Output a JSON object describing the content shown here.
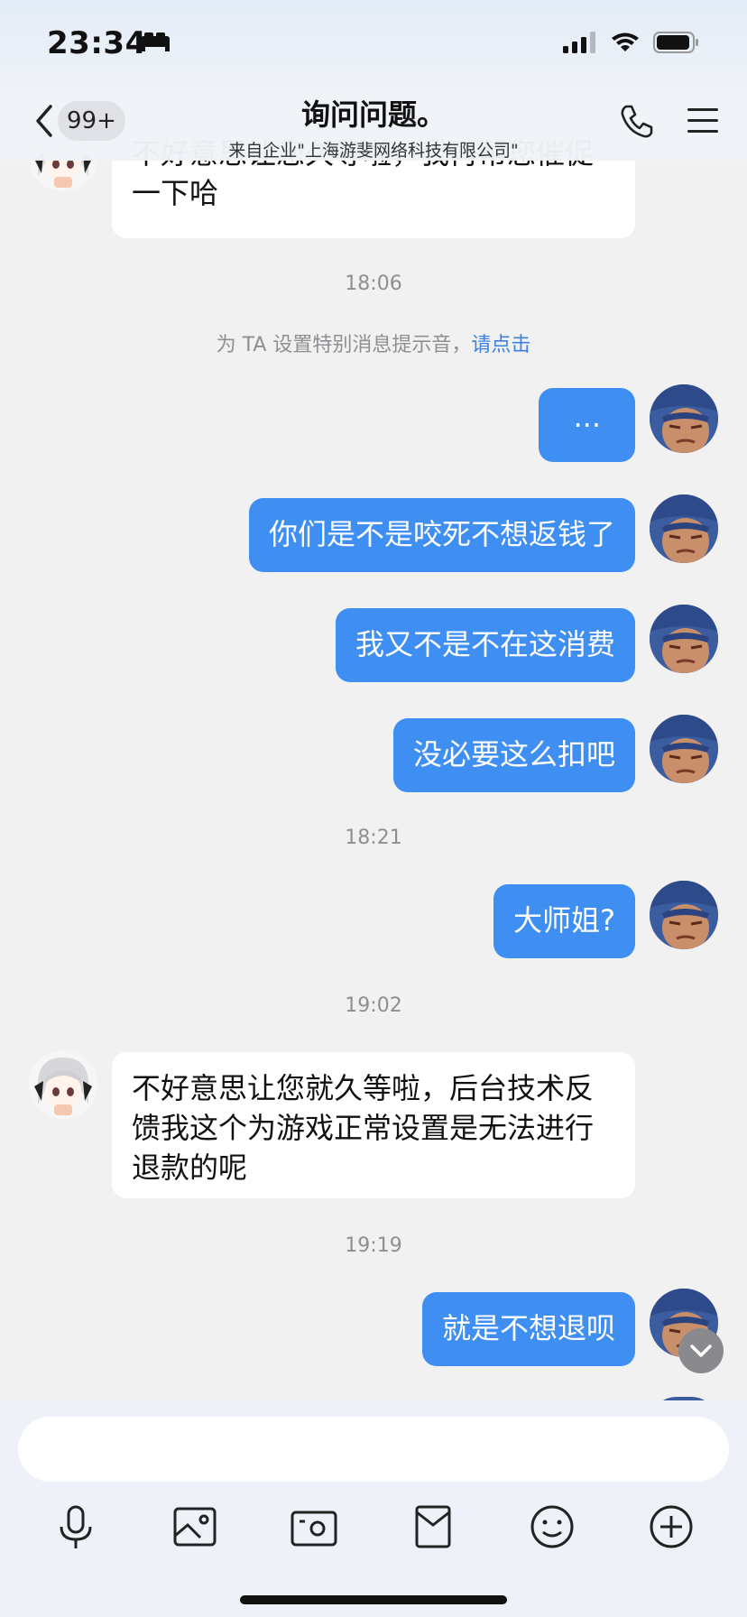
{
  "status_bar": {
    "time": "23:34",
    "focus_icon": "bed-icon",
    "signal_icon": "signal-icon",
    "wifi_icon": "wifi-icon",
    "battery_icon": "battery-icon"
  },
  "header": {
    "unread_badge": "99+",
    "title": "询问问题。",
    "subtitle": "来自企业\"上海游斐网络科技有限公司\""
  },
  "messages": [
    {
      "side": "in",
      "text": "不好意思让您久等啦，我再帮您催促一下哈"
    },
    {
      "side": "out",
      "text": "···"
    },
    {
      "side": "out",
      "text": "你们是不是咬死不想返钱了"
    },
    {
      "side": "out",
      "text": "我又不是不在这消费"
    },
    {
      "side": "out",
      "text": "没必要这么扣吧"
    },
    {
      "side": "out",
      "text": "大师姐?"
    },
    {
      "side": "in",
      "text": "不好意思让您就久等啦，后台技术反馈我这个为游戏正常设置是无法进行退款的呢"
    },
    {
      "side": "out",
      "text": "就是不想退呗"
    }
  ],
  "timestamps": [
    "18:06",
    "18:21",
    "19:02",
    "19:19"
  ],
  "system_notice": {
    "text": "为 TA 设置特别消息提示音，",
    "link": "请点击"
  },
  "colors": {
    "outgoing_bubble": "#3f8ef2",
    "incoming_bubble": "#ffffff",
    "link": "#3d82e0",
    "background": "#f1f1f1"
  },
  "toolbar": [
    "mic-icon",
    "photo-icon",
    "camera-icon",
    "red-packet-icon",
    "emoji-icon",
    "plus-icon"
  ]
}
